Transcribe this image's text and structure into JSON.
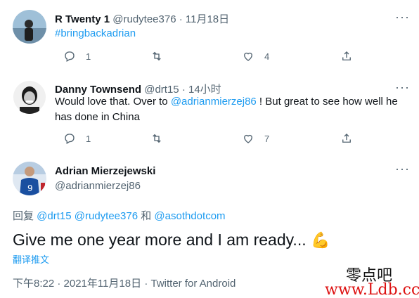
{
  "tweets": [
    {
      "name": "R Twenty 1",
      "handle": "@rudytee376",
      "separator": "·",
      "time": "11月18日",
      "text_link": "#bringbackadrian",
      "replies": "1",
      "retweets": "",
      "likes": "4"
    },
    {
      "name": "Danny Townsend",
      "handle": "@drt15",
      "separator": "·",
      "time": "14小时",
      "text_before": "Would love that. Over to ",
      "mention": "@adrianmierzej86",
      "text_after": " ! But great to see how well he has done in China",
      "replies": "1",
      "retweets": "",
      "likes": "7"
    }
  ],
  "main": {
    "name": "Adrian Mierzejewski",
    "handle": "@adrianmierzej86",
    "reply_prefix": "回复 ",
    "reply_mentions": [
      "@drt15",
      "@rudytee376",
      "@asothdotcom"
    ],
    "reply_joiner": "和",
    "text": "Give me one year more and I am ready...",
    "emoji": "💪",
    "translate": "翻译推文",
    "timestamp": "下午8:22 · 2021年11月18日 · Twitter for Android"
  },
  "watermark": {
    "line1": "零点吧",
    "line2": "www.Ldb.cc"
  },
  "icons": [
    "reply-icon",
    "retweet-icon",
    "like-icon",
    "share-icon",
    "more-icon"
  ],
  "colors": {
    "link": "#1d9bf0",
    "muted": "#536471",
    "text": "#0f1419"
  }
}
